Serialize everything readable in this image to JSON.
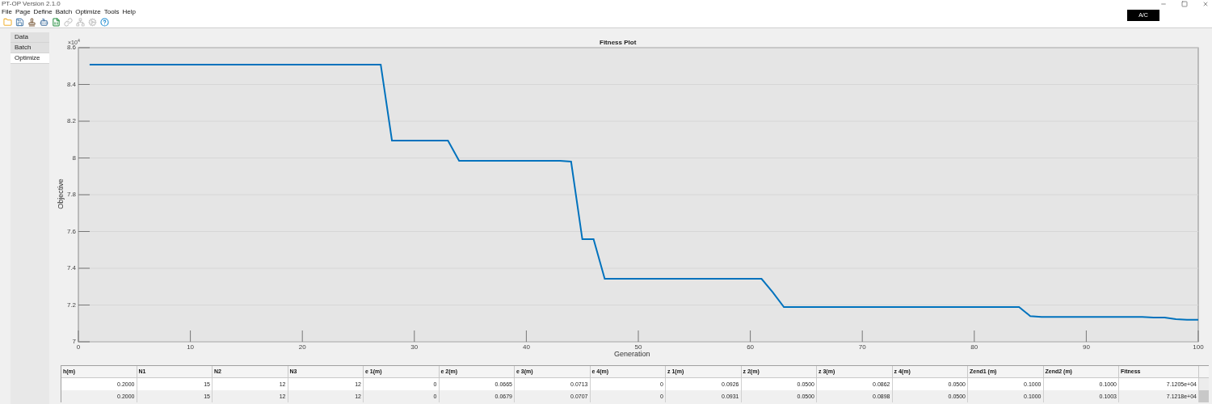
{
  "window": {
    "title": "PT-OP Version 2.1.0"
  },
  "menu": [
    "File",
    "Page",
    "Define",
    "Batch",
    "Optimize",
    "Tools",
    "Help"
  ],
  "toolbar": [
    {
      "kind": "folder",
      "disabled": false
    },
    {
      "kind": "save",
      "disabled": false
    },
    {
      "kind": "stamp",
      "disabled": false
    },
    {
      "kind": "bot",
      "disabled": false
    },
    {
      "kind": "sheet",
      "disabled": false
    },
    {
      "kind": "link",
      "disabled": true
    },
    {
      "kind": "network",
      "disabled": true
    },
    {
      "kind": "cog",
      "disabled": true
    },
    {
      "kind": "help",
      "disabled": false
    }
  ],
  "power_badge": "A/C",
  "tabs": [
    {
      "label": "Data",
      "selected": false
    },
    {
      "label": "Batch",
      "selected": false
    },
    {
      "label": "Optimize",
      "selected": true
    }
  ],
  "plot": {
    "exponent": "×10$^{4}$",
    "chart_data": {
      "type": "line",
      "title": "Fitness Plot",
      "xlabel": "Generation",
      "ylabel": "Objective",
      "grid": true,
      "xlim": [
        0,
        100
      ],
      "ylim": [
        7,
        8.6
      ],
      "xticks": [
        0,
        10,
        20,
        30,
        40,
        50,
        60,
        70,
        80,
        90,
        100
      ],
      "yticks": [
        7,
        7.2,
        7.4,
        7.6,
        7.8,
        8,
        8.2,
        8.4,
        8.6
      ],
      "x": [
        1,
        2,
        3,
        4,
        5,
        6,
        7,
        8,
        9,
        10,
        11,
        12,
        13,
        14,
        15,
        16,
        17,
        18,
        19,
        20,
        21,
        22,
        23,
        24,
        25,
        26,
        27,
        28,
        29,
        30,
        31,
        32,
        33,
        34,
        35,
        36,
        37,
        38,
        39,
        40,
        41,
        42,
        43,
        44,
        45,
        46,
        47,
        48,
        49,
        50,
        51,
        52,
        53,
        54,
        55,
        56,
        57,
        58,
        59,
        60,
        61,
        62,
        63,
        64,
        65,
        66,
        67,
        68,
        69,
        70,
        71,
        72,
        73,
        74,
        75,
        76,
        77,
        78,
        79,
        80,
        81,
        82,
        83,
        84,
        85,
        86,
        87,
        88,
        89,
        90,
        91,
        92,
        93,
        94,
        95,
        96,
        97,
        98,
        99,
        100
      ],
      "series": [
        {
          "color": "#0072bd",
          "values": [
            8.508,
            8.508,
            8.508,
            8.508,
            8.508,
            8.508,
            8.508,
            8.508,
            8.508,
            8.508,
            8.508,
            8.508,
            8.508,
            8.508,
            8.508,
            8.508,
            8.508,
            8.508,
            8.508,
            8.508,
            8.508,
            8.508,
            8.508,
            8.508,
            8.508,
            8.508,
            8.508,
            8.095,
            8.095,
            8.095,
            8.095,
            8.095,
            8.095,
            7.985,
            7.985,
            7.985,
            7.985,
            7.985,
            7.985,
            7.985,
            7.985,
            7.985,
            7.985,
            7.98,
            7.558,
            7.558,
            7.343,
            7.343,
            7.343,
            7.343,
            7.343,
            7.343,
            7.343,
            7.343,
            7.343,
            7.343,
            7.343,
            7.343,
            7.343,
            7.343,
            7.343,
            7.27,
            7.189,
            7.189,
            7.189,
            7.189,
            7.189,
            7.189,
            7.189,
            7.189,
            7.189,
            7.189,
            7.189,
            7.189,
            7.189,
            7.189,
            7.189,
            7.189,
            7.189,
            7.189,
            7.189,
            7.189,
            7.189,
            7.189,
            7.14,
            7.135,
            7.135,
            7.135,
            7.135,
            7.135,
            7.135,
            7.135,
            7.135,
            7.135,
            7.135,
            7.132,
            7.132,
            7.123,
            7.12,
            7.12
          ]
        }
      ]
    }
  },
  "table": {
    "columns": [
      "h(m)",
      "N1",
      "N2",
      "N3",
      "e 1(m)",
      "e 2(m)",
      "e 3(m)",
      "e 4(m)",
      "z 1(m)",
      "z 2(m)",
      "z 3(m)",
      "z 4(m)",
      "Zend1 (m)",
      "Zend2 (m)",
      "Fitness"
    ],
    "rows": [
      [
        "0.2000",
        "15",
        "12",
        "12",
        "0",
        "0.0665",
        "0.0713",
        "0",
        "0.0926",
        "0.0500",
        "0.0862",
        "0.0500",
        "0.1000",
        "0.1000",
        "7.1205e+04"
      ],
      [
        "0.2000",
        "15",
        "12",
        "12",
        "0",
        "0.0679",
        "0.0707",
        "0",
        "0.0931",
        "0.0500",
        "0.0898",
        "0.0500",
        "0.1000",
        "0.1003",
        "7.1218e+04"
      ]
    ]
  }
}
